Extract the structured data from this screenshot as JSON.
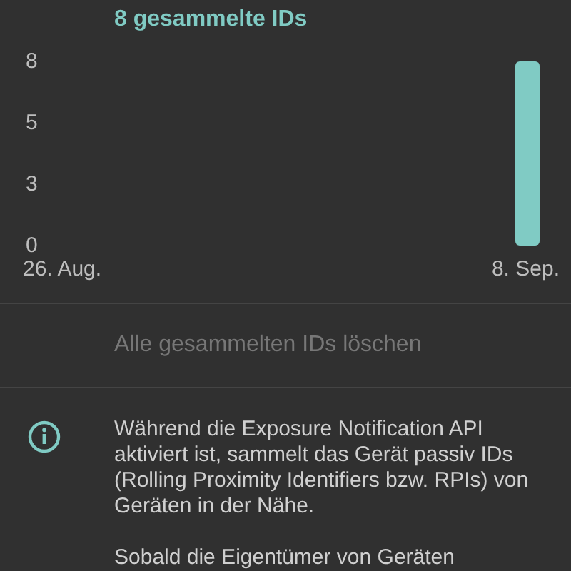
{
  "header": {
    "title": "8 gesammelte IDs"
  },
  "chart_data": {
    "type": "bar",
    "categories": [
      "26. Aug.",
      "8. Sep."
    ],
    "values": [
      0,
      8
    ],
    "ylim": [
      0,
      8
    ],
    "yticks": [
      0,
      {
        "value": 2.667,
        "label": "3"
      },
      {
        "value": 5.333,
        "label": "5"
      },
      8
    ]
  },
  "delete_button": {
    "label": "Alle gesammelten IDs löschen",
    "disabled": true
  },
  "info": {
    "paragraphs": [
      "Während die Exposure Notification API aktiviert ist, sammelt das Gerät passiv IDs (Rolling Proximity Identifiers bzw. RPIs) von Geräten in der Nähe.",
      "Sobald die Eigentümer von Geräten"
    ]
  }
}
